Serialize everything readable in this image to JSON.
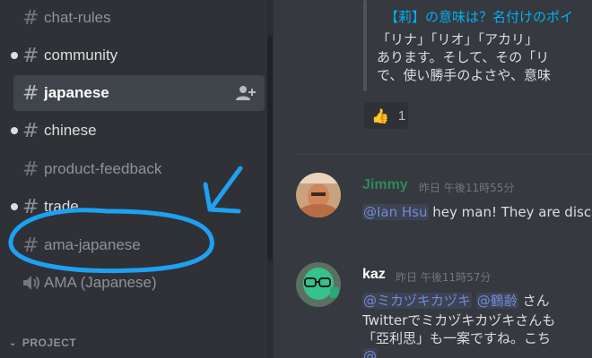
{
  "sidebar": {
    "channels": [
      {
        "name": "chat-rules",
        "icon": "hash-icon"
      },
      {
        "name": "community",
        "icon": "hash-icon"
      },
      {
        "name": "japanese",
        "icon": "hash-icon"
      },
      {
        "name": "chinese",
        "icon": "hash-icon"
      },
      {
        "name": "product-feedback",
        "icon": "hash-icon"
      },
      {
        "name": "trade",
        "icon": "hash-icon"
      },
      {
        "name": "ama-japanese",
        "icon": "hash-icon"
      },
      {
        "name": "AMA (Japanese)",
        "icon": "speaker-icon"
      }
    ],
    "hash_glyph": "#",
    "category": "PROJECT",
    "category_chevron": "⌄"
  },
  "chat": {
    "embed": {
      "title": "【莉】の意味は？名付けのポイ",
      "lines": [
        "「リナ」「リオ」「アカリ」",
        "あります。そして、その「リ",
        "で、使い勝手のよさや、意味"
      ]
    },
    "reaction": {
      "emoji": "👍",
      "count": "1"
    },
    "messages": [
      {
        "author": "Jimmy",
        "author_color": "#2e8b57",
        "timestamp": "昨日 午後11時55分",
        "mention": "@Ian Hsu",
        "text": " hey man! They are disc"
      },
      {
        "author": "kaz",
        "author_color": "#ffffff",
        "timestamp": "昨日 午後11時57分",
        "line1_mention1": "@ミカヅキカヅキ",
        "line1_mention2": "@鶴齢",
        "line1_text": " さん",
        "line2": "Twitterでミカヅキカヅキさんも",
        "line3": "「亞利思」も一案ですね。こち",
        "line4_mention": "@"
      }
    ]
  },
  "colors": {
    "annotation": "#1da1f2"
  }
}
